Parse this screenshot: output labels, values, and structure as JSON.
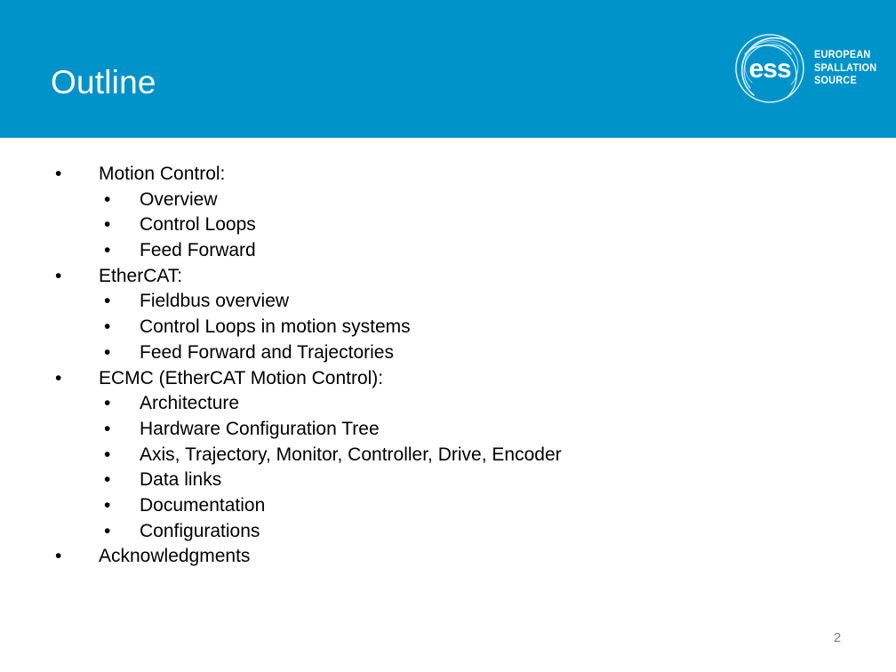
{
  "slide": {
    "title": "Outline",
    "page_number": "2",
    "header_color": "#0093c9",
    "title_color": "#ffffff",
    "body_text_color": "#000000",
    "page_number_color": "#808080"
  },
  "logo": {
    "mark_text": "ess",
    "line1": "EUROPEAN",
    "line2": "SPALLATION",
    "line3": "SOURCE"
  },
  "outline": {
    "rows": [
      {
        "level": 1,
        "bullet": "•",
        "text": "Motion Control:"
      },
      {
        "level": 2,
        "bullet": "•",
        "text": "Overview"
      },
      {
        "level": 2,
        "bullet": "•",
        "text": "Control Loops"
      },
      {
        "level": 2,
        "bullet": "•",
        "text": "Feed Forward"
      },
      {
        "level": 1,
        "bullet": "•",
        "text": "EtherCAT:"
      },
      {
        "level": 2,
        "bullet": "•",
        "text": "Fieldbus overview"
      },
      {
        "level": 2,
        "bullet": "•",
        "text": "Control Loops in motion systems"
      },
      {
        "level": 2,
        "bullet": "•",
        "text": "Feed Forward and Trajectories"
      },
      {
        "level": 1,
        "bullet": "•",
        "text": "ECMC (EtherCAT Motion Control):"
      },
      {
        "level": 2,
        "bullet": "•",
        "text": "Architecture"
      },
      {
        "level": 2,
        "bullet": "•",
        "text": "Hardware Configuration Tree"
      },
      {
        "level": 2,
        "bullet": "•",
        "text": "Axis, Trajectory, Monitor, Controller, Drive, Encoder"
      },
      {
        "level": 2,
        "bullet": "•",
        "text": "Data links"
      },
      {
        "level": 2,
        "bullet": "•",
        "text": "Documentation"
      },
      {
        "level": 2,
        "bullet": "•",
        "text": "Configurations"
      },
      {
        "level": 1,
        "bullet": "•",
        "text": "Acknowledgments"
      }
    ]
  }
}
